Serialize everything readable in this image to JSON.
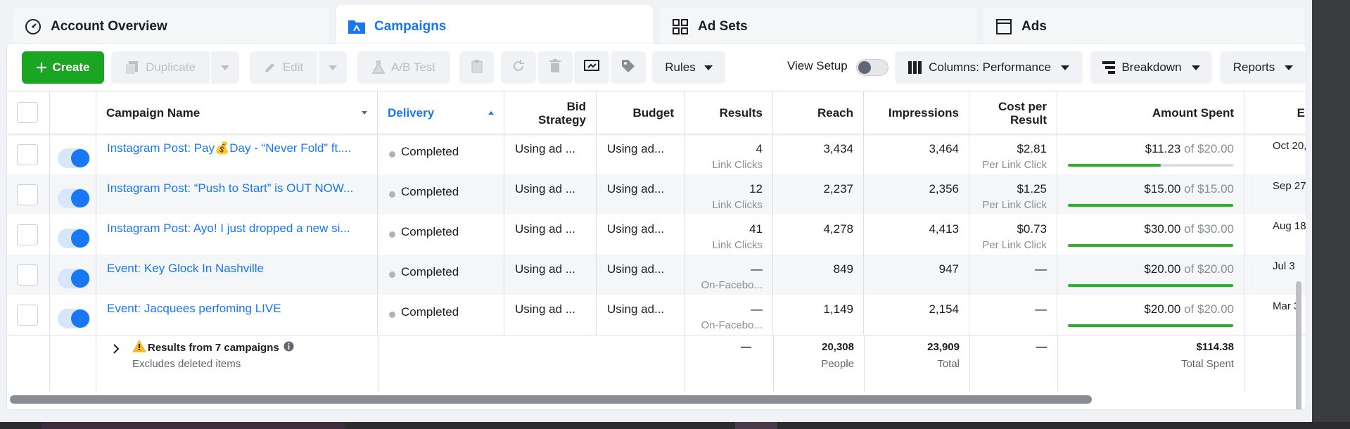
{
  "tabs": [
    {
      "label": "Account Overview",
      "icon": "gauge-icon"
    },
    {
      "label": "Campaigns",
      "icon": "folder-icon"
    },
    {
      "label": "Ad Sets",
      "icon": "grid-icon"
    },
    {
      "label": "Ads",
      "icon": "window-icon"
    }
  ],
  "toolbar": {
    "create": "Create",
    "duplicate": "Duplicate",
    "edit": "Edit",
    "ab_test": "A/B Test",
    "rules": "Rules",
    "view_setup": "View Setup",
    "columns": "Columns: Performance",
    "breakdown": "Breakdown",
    "reports": "Reports"
  },
  "headers": {
    "campaign_name": "Campaign Name",
    "delivery": "Delivery",
    "bid_strategy_1": "Bid",
    "bid_strategy_2": "Strategy",
    "budget": "Budget",
    "results": "Results",
    "reach": "Reach",
    "impressions": "Impressions",
    "cost_per_result_1": "Cost per",
    "cost_per_result_2": "Result",
    "amount_spent": "Amount Spent",
    "ends": "E"
  },
  "rows": [
    {
      "name": "Instagram Post: Pay💰Day - “Never Fold” ft....",
      "delivery": "Completed",
      "bid": "Using ad ...",
      "budget": "Using ad...",
      "results": "4",
      "results_type": "Link Clicks",
      "reach": "3,434",
      "impressions": "3,464",
      "cpr": "$2.81",
      "cpr_type": "Per Link Click",
      "spent": "$11.23",
      "spent_of": "of $20.00",
      "spent_fraction": 0.56,
      "date": "Oct 20,"
    },
    {
      "name": "Instagram Post: “Push to Start” is OUT NOW...",
      "delivery": "Completed",
      "bid": "Using ad ...",
      "budget": "Using ad...",
      "results": "12",
      "results_type": "Link Clicks",
      "reach": "2,237",
      "impressions": "2,356",
      "cpr": "$1.25",
      "cpr_type": "Per Link Click",
      "spent": "$15.00",
      "spent_of": "of $15.00",
      "spent_fraction": 1.0,
      "date": "Sep 27,"
    },
    {
      "name": "Instagram Post: Ayo! I just dropped a new si...",
      "delivery": "Completed",
      "bid": "Using ad ...",
      "budget": "Using ad...",
      "results": "41",
      "results_type": "Link Clicks",
      "reach": "4,278",
      "impressions": "4,413",
      "cpr": "$0.73",
      "cpr_type": "Per Link Click",
      "spent": "$30.00",
      "spent_of": "of $30.00",
      "spent_fraction": 1.0,
      "date": "Aug 18"
    },
    {
      "name": "Event: Key Glock In Nashville",
      "delivery": "Completed",
      "bid": "Using ad ...",
      "budget": "Using ad...",
      "results": "—",
      "results_type": "On-Facebo...",
      "reach": "849",
      "impressions": "947",
      "cpr": "—",
      "cpr_type": "",
      "spent": "$20.00",
      "spent_of": "of $20.00",
      "spent_fraction": 1.0,
      "date": "Jul 3"
    },
    {
      "name": "Event: Jacquees perfoming LIVE",
      "delivery": "Completed",
      "bid": "Using ad ...",
      "budget": "Using ad...",
      "results": "—",
      "results_type": "On-Facebo...",
      "reach": "1,149",
      "impressions": "2,154",
      "cpr": "—",
      "cpr_type": "",
      "spent": "$20.00",
      "spent_of": "of $20.00",
      "spent_fraction": 1.0,
      "date": "Mar 3"
    }
  ],
  "summary": {
    "title": "Results from 7 campaigns",
    "subtitle": "Excludes deleted items",
    "results": "—",
    "reach": "20,308",
    "reach_label": "People",
    "impressions": "23,909",
    "impressions_label": "Total",
    "cpr": "—",
    "spent": "$114.38",
    "spent_label": "Total Spent"
  },
  "colors": {
    "accent": "#1877f2",
    "create": "#1aa522",
    "progress": "#2fb12f"
  }
}
